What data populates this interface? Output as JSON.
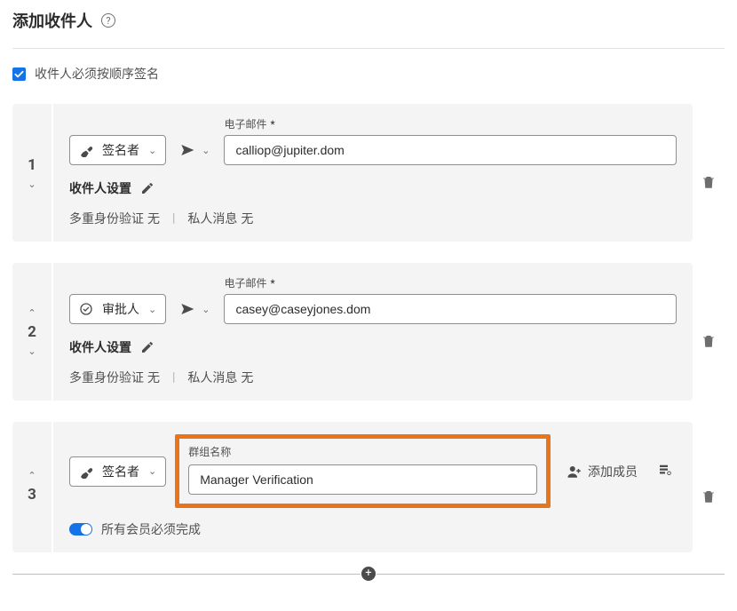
{
  "header": {
    "title": "添加收件人"
  },
  "orderCheckbox": {
    "checked": true,
    "label": "收件人必须按顺序签名"
  },
  "recipients": [
    {
      "order": "1",
      "role": {
        "label": "签名者",
        "icon": "pen-nib"
      },
      "emailLabel": "电子邮件",
      "emailRequiredMark": "*",
      "email": "calliop@jupiter.dom",
      "settingsTitle": "收件人设置",
      "mfaLabel": "多重身份验证",
      "mfaValue": "无",
      "pmLabel": "私人消息",
      "pmValue": "无"
    },
    {
      "order": "2",
      "role": {
        "label": "审批人",
        "icon": "check-circle"
      },
      "emailLabel": "电子邮件",
      "emailRequiredMark": "*",
      "email": "casey@caseyjones.dom",
      "settingsTitle": "收件人设置",
      "mfaLabel": "多重身份验证",
      "mfaValue": "无",
      "pmLabel": "私人消息",
      "pmValue": "无"
    }
  ],
  "group": {
    "order": "3",
    "role": {
      "label": "签名者",
      "icon": "pen-nib"
    },
    "groupNameLabel": "群组名称",
    "groupName": "Manager Verification",
    "addMemberLabel": "添加成员",
    "toggleLabel": "所有会员必须完成",
    "toggleOn": true
  }
}
